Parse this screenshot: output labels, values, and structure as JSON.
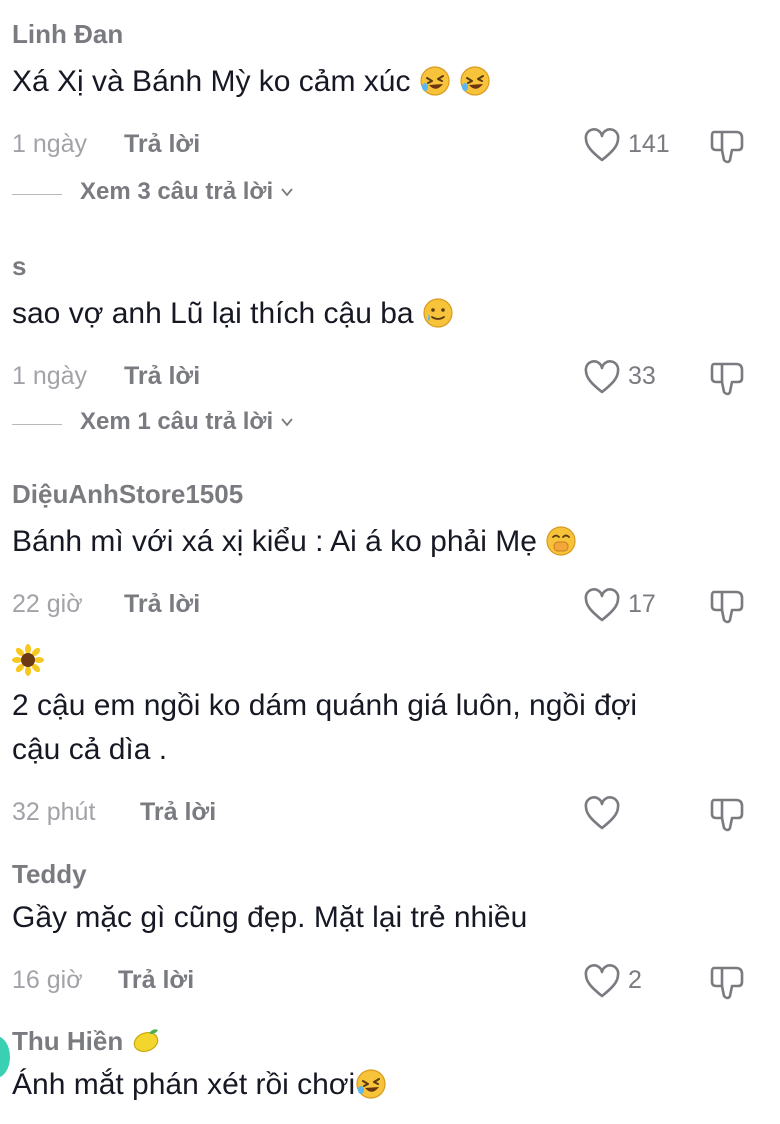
{
  "comments": [
    {
      "author": "Linh Đan",
      "text": "Xá Xị và Bánh Mỳ ko cảm xúc",
      "emoji": [
        "rofl-emoji",
        "rofl-emoji"
      ],
      "time": "1 ngày",
      "reply": "Trả lời",
      "likes": "141",
      "view_replies": "Xem 3 câu trả lời"
    },
    {
      "author": "s",
      "text": "sao vợ anh Lũ lại thích cậu ba",
      "emoji": [
        "tearful-smile-emoji"
      ],
      "time": "1 ngày",
      "reply": "Trả lời",
      "likes": "33",
      "view_replies": "Xem 1 câu trả lời"
    },
    {
      "author": "DiệuAnhStore1505",
      "text": "Bánh mì với xá xị kiểu : Ai á ko phải Mẹ",
      "emoji": [
        "hand-over-mouth-emoji"
      ],
      "time": "22 giờ",
      "reply": "Trả lời",
      "likes": "17"
    },
    {
      "author_emoji": "sunflower-emoji",
      "text_line1": "2 cậu em ngồi ko dám quánh giá luôn, ngồi đợi",
      "text_line2": "cậu cả dìa .",
      "time": "32 phút",
      "reply": "Trả lời",
      "likes": ""
    },
    {
      "author": "Teddy",
      "text": "Gầy mặc gì cũng đẹp. Mặt lại trẻ nhiều",
      "time": "16 giờ",
      "reply": "Trả lời",
      "likes": "2"
    },
    {
      "author": "Thu Hiền",
      "author_emoji": "lemon-emoji",
      "text": "Ánh mắt phán xét rồi chơi",
      "emoji": [
        "rofl-emoji"
      ]
    }
  ],
  "icons": {
    "like": "heart-outline-icon",
    "dislike": "thumbs-down-icon",
    "expand": "chevron-down-icon"
  },
  "colors": {
    "text": "#161823",
    "muted": "#7a7b80",
    "time": "#a2a3a8"
  }
}
